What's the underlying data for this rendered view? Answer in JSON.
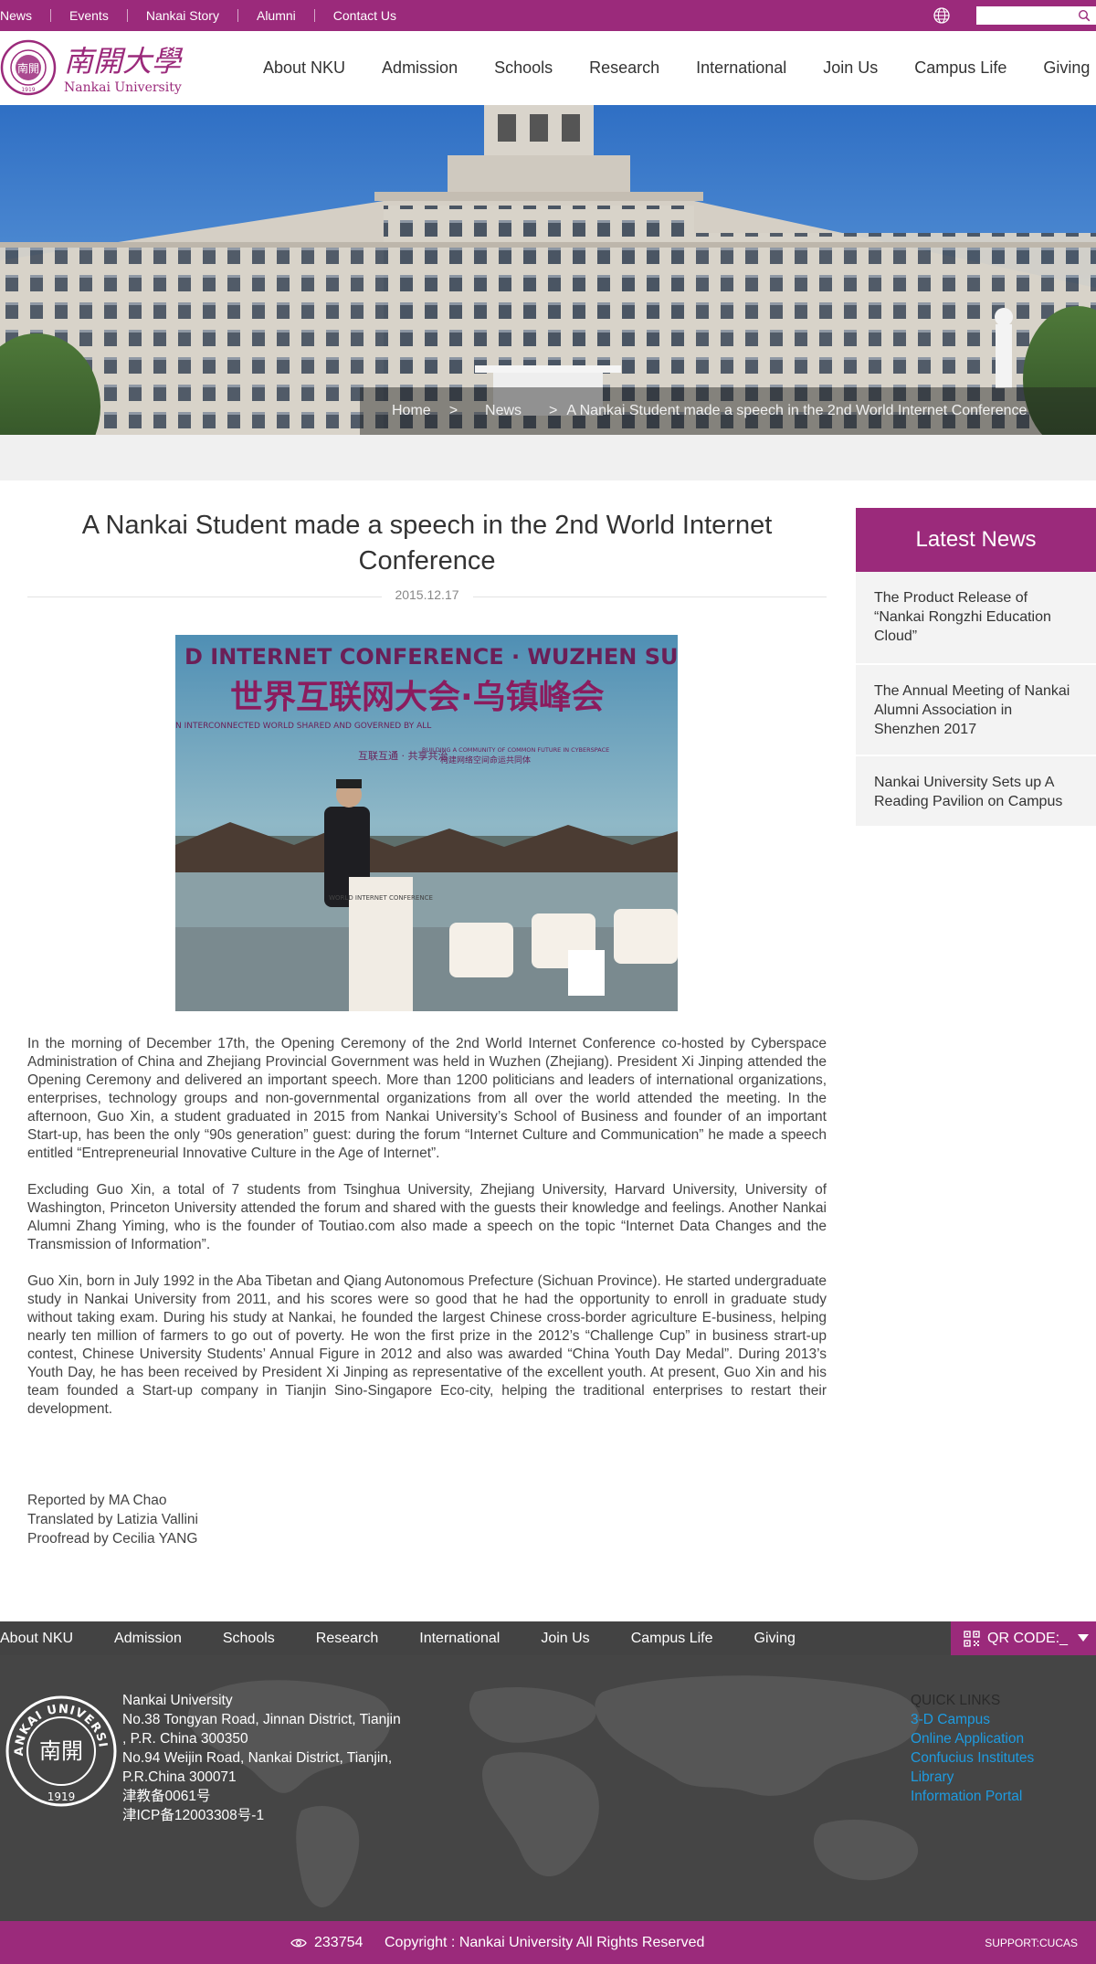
{
  "topbar": {
    "links": [
      "News",
      "Events",
      "Nankai Story",
      "Alumni",
      "Contact Us"
    ],
    "search_placeholder": ""
  },
  "header": {
    "logo_text_cn": "南開大學",
    "logo_text_en": "Nankai University",
    "nav": [
      "About NKU",
      "Admission",
      "Schools",
      "Research",
      "International",
      "Join Us",
      "Campus Life",
      "Giving"
    ]
  },
  "breadcrumb": {
    "home": "Home",
    "sep1": ">",
    "news": "News",
    "sep2": ">",
    "current": "A Nankai Student made a speech in the 2nd World Internet Conference"
  },
  "article": {
    "title": "A Nankai Student made a speech in the 2nd World Internet Conference",
    "date": "2015.12.17",
    "photo": {
      "banner_en": "D INTERNET CONFERENCE · WUZHEN SUMMIT",
      "banner_cn": "世界互联网大会·乌镇峰会",
      "sub_en": "N INTERCONNECTED WORLD SHARED AND GOVERNED BY ALL",
      "sub_cn": "互联互通 · 共享共治",
      "sub2_en": "BUILDING A COMMUNITY OF COMMON FUTURE IN CYBERSPACE",
      "sub2_cn": "构建网络空间命运共同体",
      "podium": "WORLD INTERNET CONFERENCE"
    },
    "paragraphs": [
      "In the morning of December 17th, the Opening Ceremony of the 2nd World Internet Conference co-hosted by Cyberspace Administration of China and Zhejiang Provincial Government was held in Wuzhen (Zhejiang). President Xi Jinping attended the Opening Ceremony and delivered an important speech. More than 1200 politicians and leaders of international organizations, enterprises, technology groups and non-governmental organizations from all over the world attended the meeting. In the afternoon, Guo Xin, a student graduated in 2015 from Nankai University’s School of Business and founder of an important Start-up, has been the only “90s generation” guest: during the forum “Internet Culture and Communication” he made a speech entitled “Entrepreneurial Innovative Culture in the Age of Internet”.",
      "Excluding Guo Xin, a total of 7 students from Tsinghua University, Zhejiang University, Harvard University, University of Washington, Princeton University attended the forum and shared with the guests their knowledge and feelings. Another Nankai Alumni Zhang Yiming, who is the founder of Toutiao.com also made a speech on the topic “Internet Data Changes and the Transmission of Information”.",
      "Guo Xin, born in July 1992 in the Aba Tibetan and Qiang Autonomous Prefecture (Sichuan Province). He started undergraduate study in Nankai University from 2011, and his scores were so good that he had the opportunity to enroll in graduate study without taking exam. During his study at Nankai, he founded the largest Chinese cross-border agriculture E-business, helping nearly ten million of farmers to go out of poverty. He won the first prize in the 2012’s “Challenge Cup” in business strart-up contest, Chinese University Students’ Annual Figure in 2012 and also was awarded “China Youth Day Medal”. During 2013’s Youth Day, he has been received by President Xi Jinping as representative of the excellent youth. At present, Guo Xin and his team founded a Start-up company in Tianjin Sino-Singapore Eco-city, helping the traditional enterprises to restart their development."
    ],
    "credits": [
      "Reported by MA Chao",
      "Translated by Latizia Vallini",
      "Proofread by Cecilia YANG"
    ]
  },
  "sidebar": {
    "title": "Latest News",
    "items": [
      "The Product Release of “Nankai Rongzhi Education Cloud”",
      "The Annual Meeting of Nankai Alumni Association in Shenzhen 2017",
      "Nankai University Sets up A Reading Pavilion on Campus"
    ]
  },
  "footer": {
    "nav": [
      "About NKU",
      "Admission",
      "Schools",
      "Research",
      "International",
      "Join Us",
      "Campus Life",
      "Giving"
    ],
    "qr_label": "QR CODE:_",
    "seal_text": "NANKAI UNIVERSITY",
    "seal_year": "1919",
    "address": [
      "Nankai University",
      "No.38 Tongyan Road, Jinnan District, Tianjin",
      ", P.R. China 300350",
      "No.94 Weijin Road,  Nankai District, Tianjin,",
      "P.R.China  300071",
      "津教备0061号",
      "津ICP备12003308号-1"
    ],
    "quick_links_title": "QUICK LINKS",
    "quick_links": [
      "3-D Campus",
      "Online Application",
      "Confucius Institutes",
      "Library",
      "Information Portal"
    ],
    "visit_count": "233754",
    "copyright": "Copyright : Nankai University All Rights Reserved",
    "support": "SUPPORT:CUCAS"
  },
  "colors": {
    "brand_purple": "#9b2a7b",
    "footer_grey": "#454545",
    "link_blue": "#1e9be0"
  }
}
